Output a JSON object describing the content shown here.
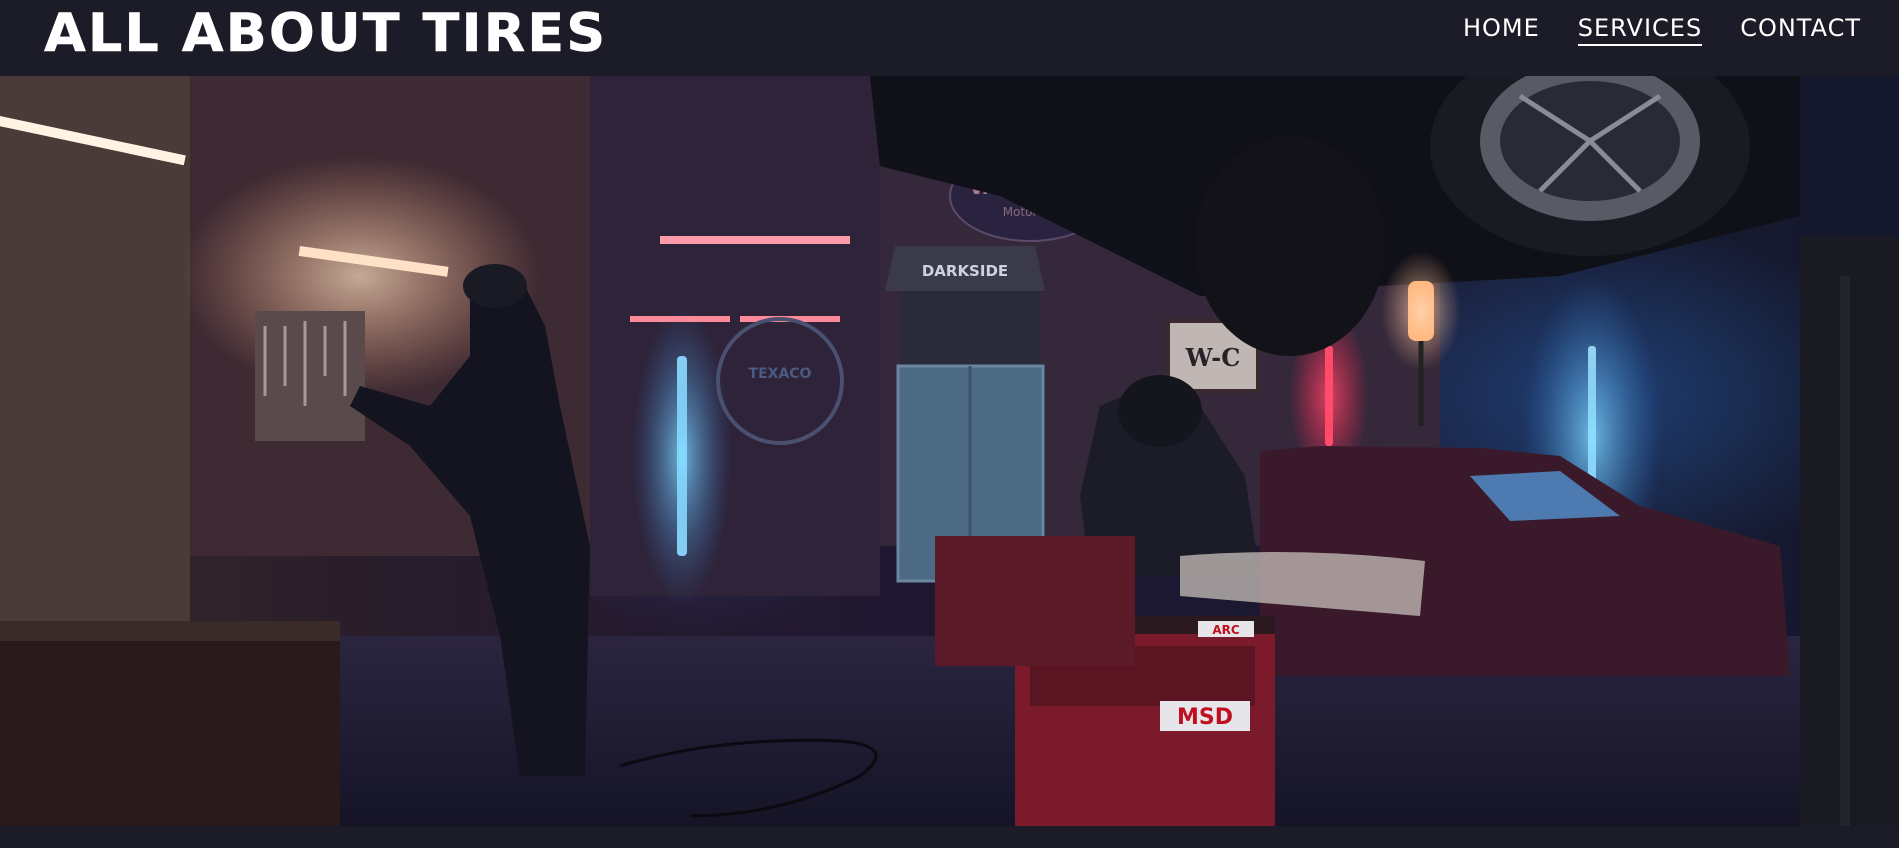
{
  "brand": {
    "name": "ALL ABOUT TIRES"
  },
  "nav": {
    "items": [
      {
        "label": "HOME",
        "active": false
      },
      {
        "label": "SERVICES",
        "active": true
      },
      {
        "label": "CONTACT",
        "active": false
      }
    ]
  },
  "hero": {
    "scene": {
      "signs": [
        "VALVOLINE",
        "Motor Oil",
        "DARKSIDE",
        "TEXACO",
        "W-C",
        "MSD",
        "ARC"
      ]
    }
  },
  "colors": {
    "navbar_bg": "#1c1c29",
    "text": "#ffffff",
    "neon_blue": "#6fd0ff",
    "neon_red": "#ff3a5c"
  }
}
